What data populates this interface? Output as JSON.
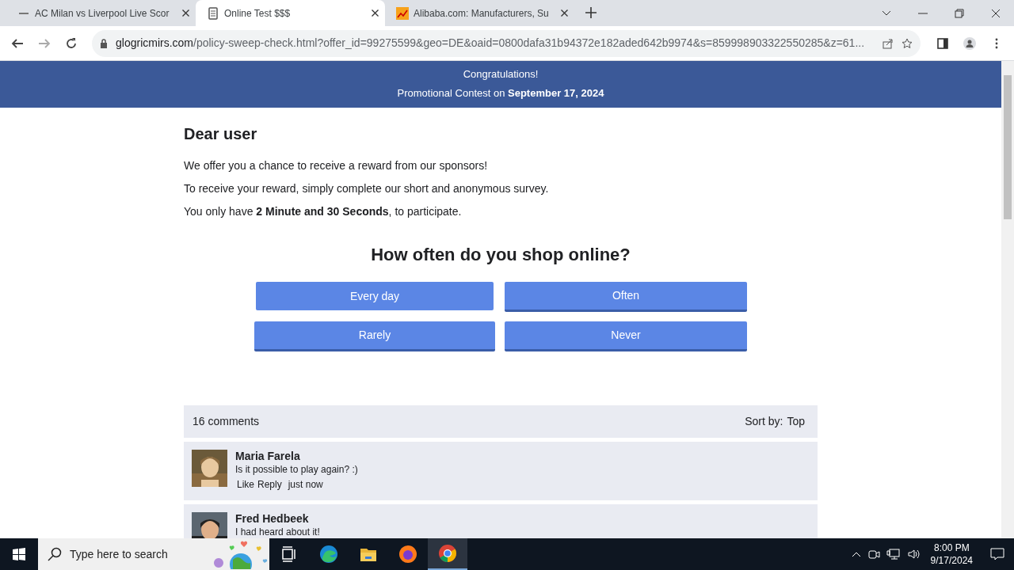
{
  "browser": {
    "tabs": [
      {
        "title": "AC Milan vs Liverpool Live Scor",
        "selected": false
      },
      {
        "title": "Online Test $$$",
        "selected": true
      },
      {
        "title": "Alibaba.com: Manufacturers, Su",
        "selected": false
      }
    ],
    "url": {
      "domain": "glogricmirs.com",
      "path": "/policy-sweep-check.html?offer_id=99275599&geo=DE&oaid=0800dafa31b94372e182aded642b9974&s=859998903322550285&z=61..."
    }
  },
  "page": {
    "banner": {
      "line_1": "Congratulations!",
      "line_2": "Promotional Contest on **September 17, 2024**"
    },
    "heading": "Dear user",
    "paragraphs": [
      "We offer you a chance to receive a reward from our sponsors!",
      "To receive your reward, simply complete our short and anonymous survey.",
      "You only have **2 Minute and 30 Seconds**, to participate."
    ],
    "question": "How often do you shop online?",
    "answers": [
      {
        "label": "Every day",
        "hovered": true
      },
      {
        "label": "Often",
        "hovered": false
      },
      {
        "label": "Rarely",
        "hovered": false
      },
      {
        "label": "Never",
        "hovered": false
      }
    ],
    "comments": {
      "count": "16 comments",
      "sort_label": "Sort by:",
      "sort_value": "Top",
      "items": [
        {
          "author": "Maria Farela",
          "text": "Is it possible to play again? :)",
          "actions": [
            "Like",
            "Reply"
          ],
          "time": "just now"
        },
        {
          "author": "Fred Hedbeek",
          "text": "I had heard about it!"
        }
      ]
    }
  },
  "taskbar": {
    "search_placeholder": "Type here to search",
    "time": "8:00 PM",
    "date": "9/17/2024"
  }
}
